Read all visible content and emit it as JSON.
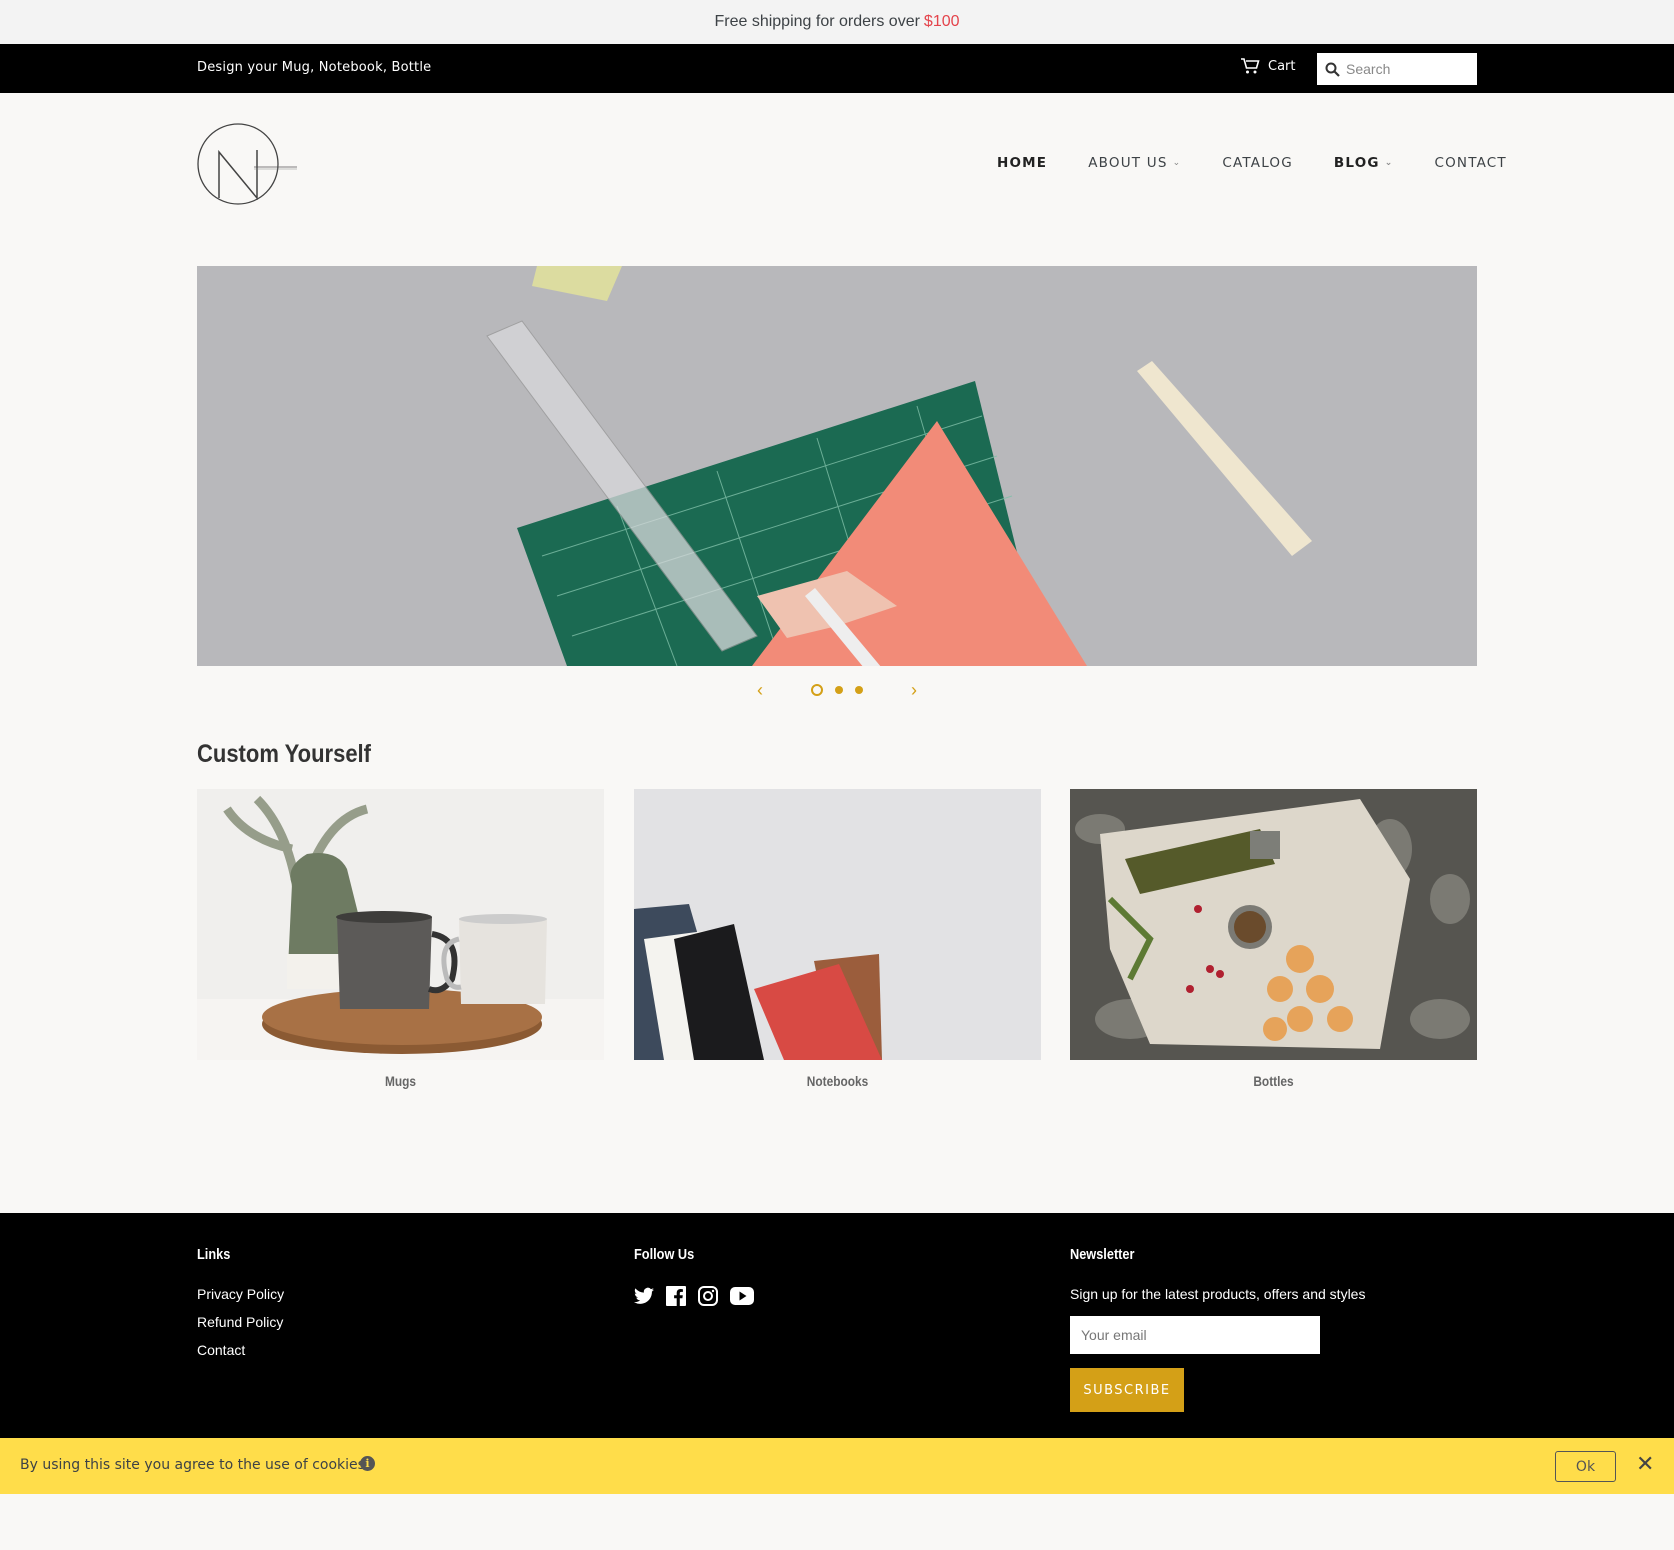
{
  "announcement": {
    "text": "Free shipping for orders over",
    "price": "$100"
  },
  "topbar": {
    "tagline": "Design your Mug, Notebook, Bottle",
    "cart_label": "Cart",
    "search_placeholder": "Search",
    "cart_icon": "cart-icon",
    "search_icon": "search-icon"
  },
  "nav": {
    "home": "HOME",
    "about": "ABOUT US",
    "catalog": "CATALOG",
    "blog": "BLOG",
    "contact": "CONTACT",
    "chevron": "⌄"
  },
  "slideshow": {
    "prev": "‹",
    "next": "›",
    "slides": 3,
    "active_slide": 1
  },
  "collections": {
    "title": "Custom Yourself",
    "items": [
      {
        "label": "Mugs"
      },
      {
        "label": "Notebooks"
      },
      {
        "label": "Bottles"
      }
    ]
  },
  "footer": {
    "links": {
      "title": "Links",
      "items": [
        "Privacy Policy",
        "Refund Policy",
        "Contact"
      ]
    },
    "follow": {
      "title": "Follow Us",
      "icons": [
        "twitter-icon",
        "facebook-icon",
        "instagram-icon",
        "youtube-icon"
      ]
    },
    "newsletter": {
      "title": "Newsletter",
      "text": "Sign up for the latest products, offers and styles",
      "email_placeholder": "Your email",
      "subscribe_label": "SUBSCRIBE"
    }
  },
  "cookie": {
    "message": "By using this site you agree to the use of cookies.",
    "info": "i",
    "ok_label": "Ok",
    "close": "✕"
  },
  "colors": {
    "accent": "#d4a017",
    "price": "#e4434b",
    "cookie_bg": "#ffdd4a",
    "footer_bg": "#000000"
  }
}
